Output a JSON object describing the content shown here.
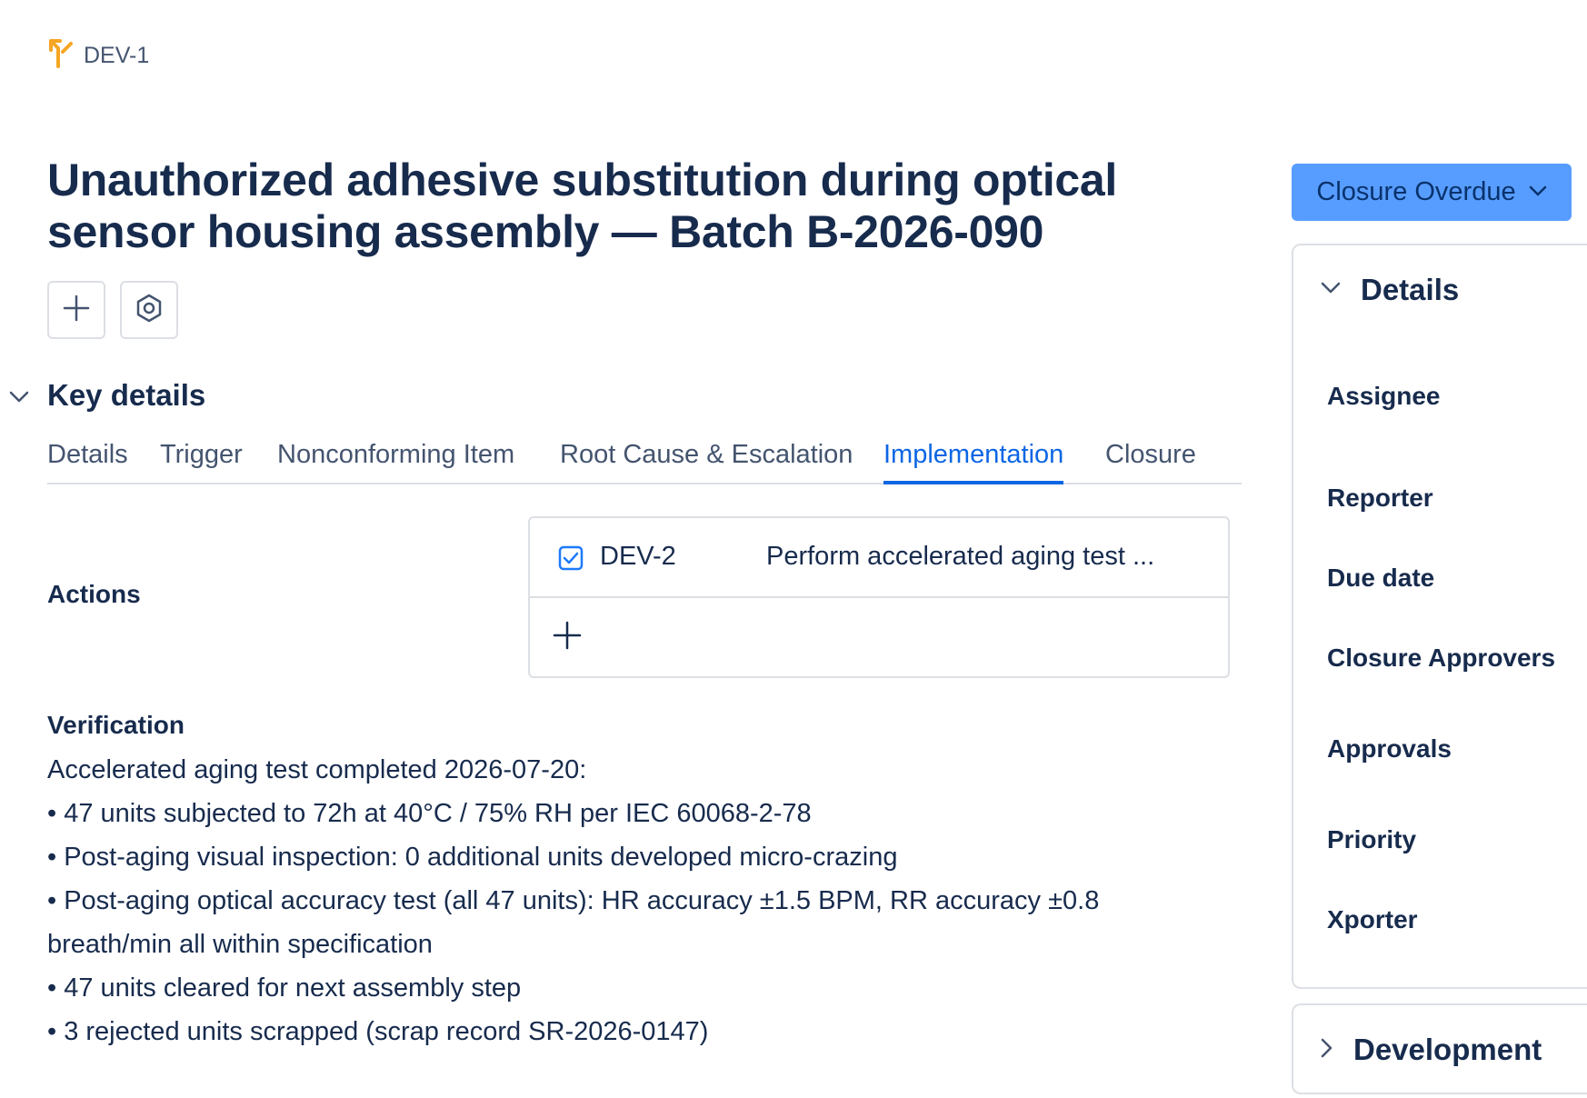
{
  "issue": {
    "key": "DEV-1",
    "type_icon": "deviation-branch-icon",
    "title": "Unauthorized adhesive substitution during optical sensor housing assembly — Batch B-2026-090"
  },
  "toolbar": {
    "add_icon": "plus-icon",
    "apps_icon": "hexagon-settings-icon"
  },
  "key_details": {
    "section_title": "Key details",
    "tabs": [
      {
        "label": "Details"
      },
      {
        "label": "Trigger"
      },
      {
        "label": "Nonconforming Item"
      },
      {
        "label": "Root Cause & Escalation"
      },
      {
        "label": "Implementation"
      },
      {
        "label": "Closure"
      }
    ],
    "active_tab": "Implementation",
    "actions": {
      "label": "Actions",
      "items": [
        {
          "key": "DEV-2",
          "summary": "Perform accelerated aging test ..."
        }
      ]
    },
    "verification": {
      "label": "Verification",
      "lines": [
        "Accelerated aging test completed 2026-07-20:",
        "• 47 units subjected to 72h at 40°C / 75% RH per IEC 60068-2-78",
        "• Post-aging visual inspection: 0 additional units developed micro-crazing",
        "• Post-aging optical accuracy test (all 47 units): HR accuracy ±1.5 BPM, RR accuracy ±0.8",
        "breath/min all within specification",
        "• 47 units cleared for next assembly step",
        "• 3 rejected units scrapped (scrap record SR-2026-0147)"
      ]
    }
  },
  "sidebar": {
    "status": "Closure Overdue",
    "status_color": "#579dff",
    "details_panel": {
      "title": "Details",
      "fields": [
        {
          "label": "Assignee"
        },
        {
          "label": "Reporter"
        },
        {
          "label": "Due date"
        },
        {
          "label": "Closure Approvers"
        },
        {
          "label": "Approvals"
        },
        {
          "label": "Priority"
        },
        {
          "label": "Xporter"
        }
      ]
    },
    "development_panel": {
      "title": "Development"
    }
  },
  "colors": {
    "accent": "#0c66e4",
    "text": "#172b4d",
    "subtle_text": "#44546f",
    "border": "#dcdfe4",
    "type_icon": "#f5a623"
  }
}
